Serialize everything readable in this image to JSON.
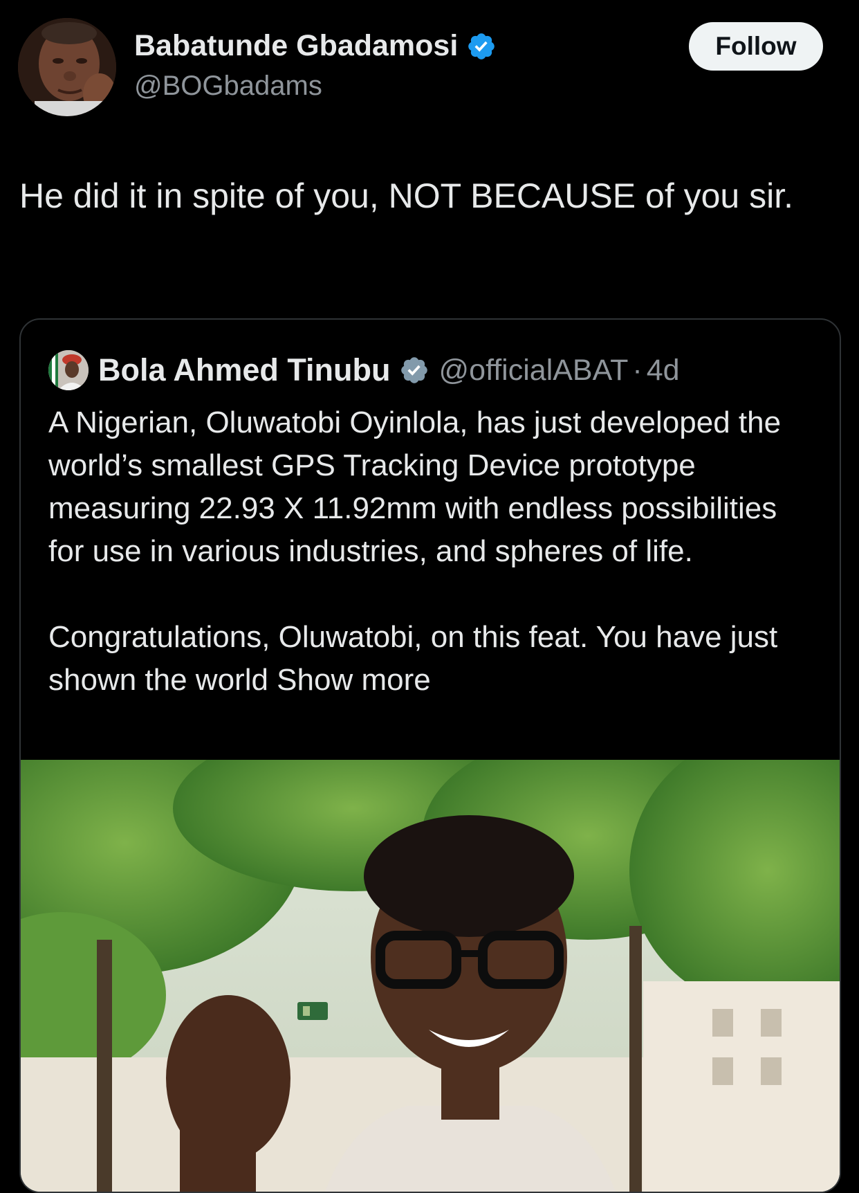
{
  "author": {
    "display_name": "Babatunde Gbadamosi",
    "handle": "@BOGbadams",
    "verified": true
  },
  "follow_button": {
    "label": "Follow"
  },
  "tweet": {
    "text": "He did it in spite of you, NOT  BECAUSE of you sir."
  },
  "quoted_tweet": {
    "display_name": "Bola Ahmed Tinubu",
    "handle": "@officialABAT",
    "separator": "·",
    "time": "4d",
    "verified": true,
    "paragraph_1": "A Nigerian, Oluwatobi Oyinlola, has just developed the world’s smallest GPS Tracking Device prototype measuring 22.93 X 11.92mm with endless possibilities for use in various industries, and spheres of life.",
    "paragraph_2_text": "Congratulations, Oluwatobi, on this feat. You have just shown the world ",
    "show_more_label": "Show more"
  },
  "colors": {
    "background": "#000000",
    "primary_text": "#e7e9ea",
    "secondary_text": "#8f959b",
    "verified_blue": "#1d9bf0",
    "verified_gray": "#829aab",
    "border": "#2f3336",
    "follow_bg": "#eff3f4"
  },
  "icons": {
    "verified_badge": "verified-badge-icon",
    "gov_badge": "gray-verified-badge-icon"
  }
}
